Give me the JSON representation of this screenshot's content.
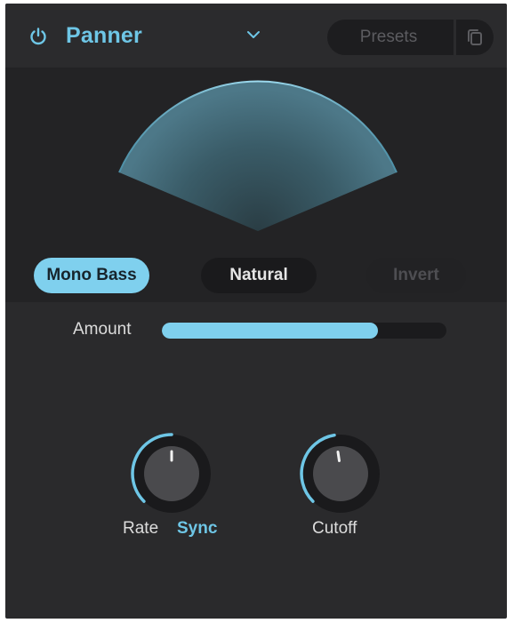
{
  "header": {
    "title": "Panner",
    "power_icon": "power-icon",
    "dropdown_icon": "chevron-down-icon",
    "presets_placeholder": "Presets",
    "copy_icon": "copy-icon"
  },
  "modes": {
    "mono_bass": "Mono Bass",
    "natural": "Natural",
    "invert": "Invert",
    "active": "Mono Bass"
  },
  "amount": {
    "label": "Amount",
    "value_fraction": 0.76
  },
  "knobs": {
    "rate": {
      "label": "Rate",
      "sync_label": "Sync"
    },
    "cutoff": {
      "label": "Cutoff"
    }
  },
  "colors": {
    "accent": "#7fd0ee",
    "title": "#6ec6e6",
    "panel": "#2a2a2c",
    "viz_bg": "#232325"
  }
}
